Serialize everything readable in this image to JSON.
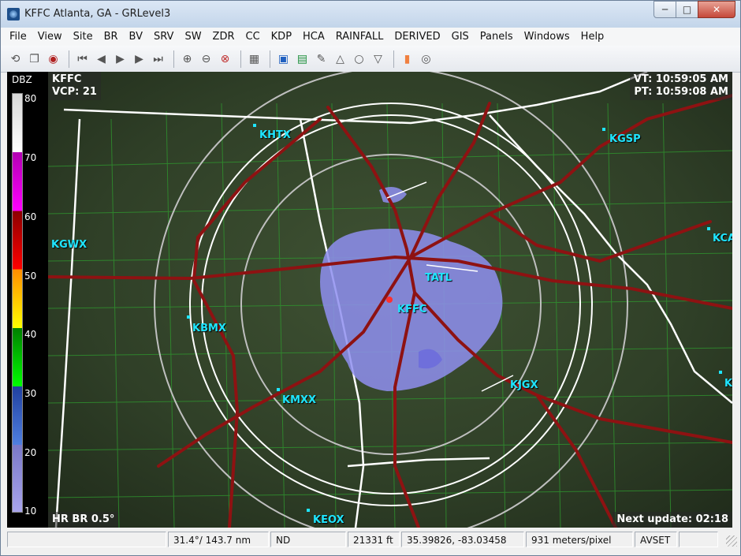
{
  "window": {
    "title": "KFFC Atlanta, GA - GRLevel3"
  },
  "window_buttons": {
    "minimize": "─",
    "maximize": "□",
    "close": "✕"
  },
  "menu": [
    "File",
    "View",
    "Site",
    "BR",
    "BV",
    "SRV",
    "SW",
    "ZDR",
    "CC",
    "KDP",
    "HCA",
    "RAINFALL",
    "DERIVED",
    "GIS",
    "Panels",
    "Windows",
    "Help"
  ],
  "toolbar": {
    "groups": [
      [
        "reload-icon",
        "copy-icon",
        "radar-icon"
      ],
      [
        "skip-first-icon",
        "step-back-icon",
        "play-icon",
        "step-forward-icon",
        "skip-last-icon"
      ],
      [
        "zoom-in-icon",
        "zoom-out-icon",
        "zoom-reset-icon"
      ],
      [
        "grid-icon"
      ],
      [
        "image-icon",
        "legend-icon",
        "pin-icon",
        "triangle-up-icon",
        "circle-icon",
        "triangle-down-icon"
      ],
      [
        "color-icon",
        "target-icon"
      ]
    ]
  },
  "legend": {
    "title": "DBZ",
    "ticks": [
      "80",
      "70",
      "60",
      "50",
      "40",
      "30",
      "20",
      "10"
    ]
  },
  "overlay": {
    "site_id": "KFFC",
    "vcp": "VCP: 21",
    "valid_time": "VT: 10:59:05 AM",
    "product_time": "PT: 10:59:08 AM",
    "product": "HR BR 0.5°",
    "next_update": "Next update: 02:18"
  },
  "sites": [
    {
      "id": "KHTX"
    },
    {
      "id": "KGSP"
    },
    {
      "id": "KGWX"
    },
    {
      "id": "KCA"
    },
    {
      "id": "TATL"
    },
    {
      "id": "KFFC"
    },
    {
      "id": "KBMX"
    },
    {
      "id": "KJGX"
    },
    {
      "id": "KMXX"
    },
    {
      "id": "K"
    },
    {
      "id": "KEOX"
    }
  ],
  "status": {
    "cell0": "",
    "bearing": "31.4°/ 143.7 nm",
    "value": "ND",
    "altitude": "21331 ft",
    "coords": "35.39826, -83.03458",
    "scale": "931 meters/pixel",
    "avset": "AVSET",
    "cell7": ""
  },
  "colors": {
    "background_map": "#2c3a24",
    "roads": "#8e1212",
    "boundaries": "#ffffff",
    "counties": "#2f9a2f",
    "echo": "#8f8ff0",
    "site_label": "#1fe5ff"
  }
}
